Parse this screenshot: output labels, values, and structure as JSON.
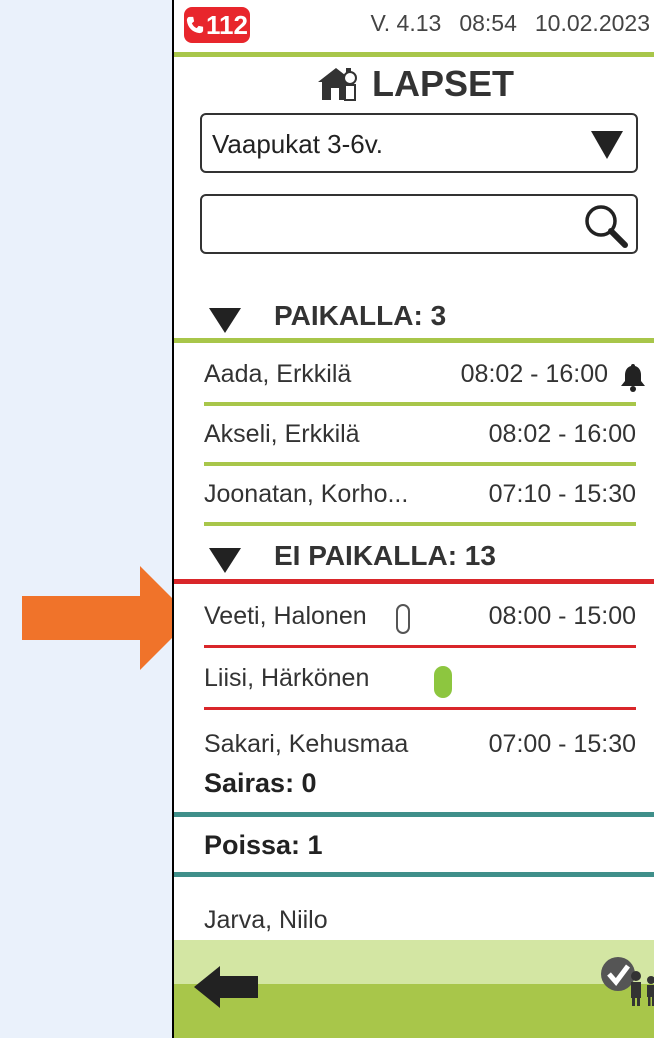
{
  "status": {
    "emergency_label": "112",
    "version": "V. 4.13",
    "time": "08:54",
    "date": "10.02.2023"
  },
  "title": "LAPSET",
  "group_select": {
    "value": "Vaapukat 3-6v."
  },
  "search": {
    "value": ""
  },
  "present": {
    "header": "PAIKALLA: 3",
    "children": [
      {
        "name": "Aada, Erkkilä",
        "time": "08:02 - 16:00",
        "icon": "bell-icon"
      },
      {
        "name": "Akseli, Erkkilä",
        "time": "08:02 - 16:00"
      },
      {
        "name": "Joonatan, Korho...",
        "time": "07:10 - 15:30"
      }
    ]
  },
  "absent": {
    "header": "EI PAIKALLA: 13",
    "children": [
      {
        "name": "Veeti, Halonen",
        "time": "08:00 - 15:00",
        "icon": "empty-pill-icon"
      },
      {
        "name": "Liisi, Härkönen",
        "time": "",
        "icon": "green-pill-icon"
      },
      {
        "name": "Sakari, Kehusmaa",
        "time": "07:00 - 15:30"
      }
    ]
  },
  "sick": {
    "header": "Sairas: 0"
  },
  "away": {
    "header": "Poissa: 1",
    "children": [
      {
        "name": "Jarva, Niilo"
      }
    ]
  },
  "colors": {
    "green": "#a8c64a",
    "red": "#d9262a",
    "teal": "#3f8f8a",
    "emergency": "#e8262c",
    "pointer": "#f0732a"
  }
}
